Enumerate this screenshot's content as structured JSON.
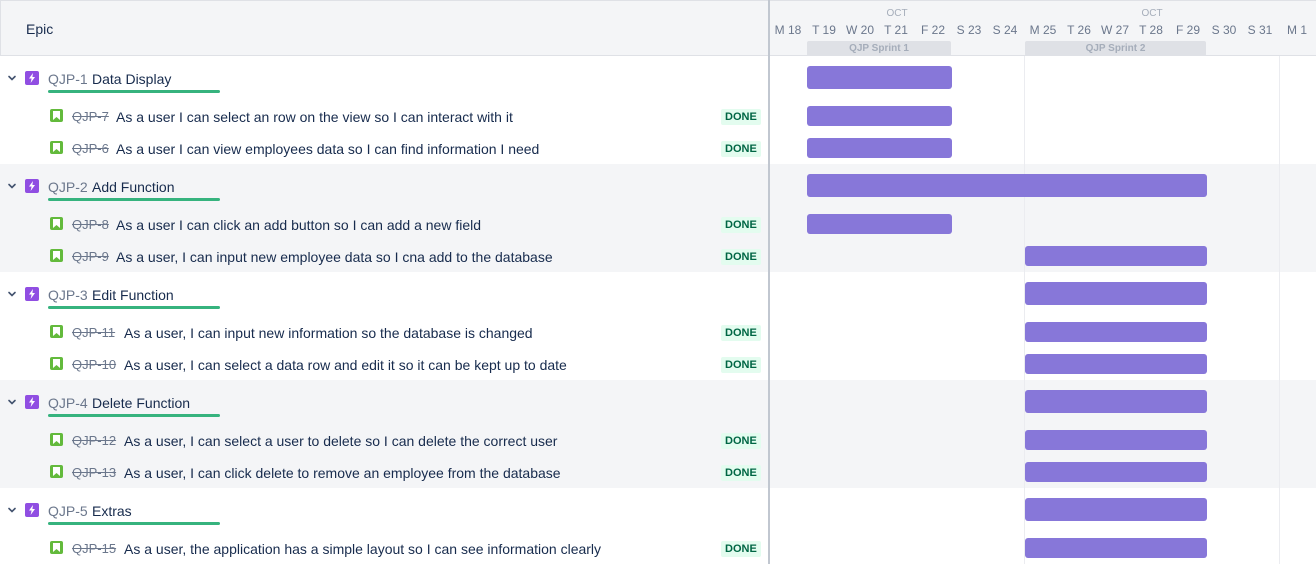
{
  "header": {
    "epic_column_title": "Epic",
    "months": [
      {
        "label": "OCT"
      },
      {
        "label": "OCT"
      }
    ],
    "days": [
      "M 18",
      "T 19",
      "W 20",
      "T 21",
      "F 22",
      "S 23",
      "S 24",
      "M 25",
      "T 26",
      "W 27",
      "T 28",
      "F 29",
      "S 30",
      "S 31",
      "M 1"
    ],
    "sprints": [
      "QJP Sprint 1",
      "QJP Sprint 2"
    ]
  },
  "epics": [
    {
      "key": "QJP-1",
      "summary": "Data Display",
      "stories": [
        {
          "key": "QJP-7",
          "summary": "As a user I can select an row on the view so I can interact with it",
          "status": "DONE"
        },
        {
          "key": "QJP-6",
          "summary": "As a user I can view employees data so I can find information I need",
          "status": "DONE"
        }
      ]
    },
    {
      "key": "QJP-2",
      "summary": "Add Function",
      "stories": [
        {
          "key": "QJP-8",
          "summary": "As a user I can click an add button so I can add a new field",
          "status": "DONE"
        },
        {
          "key": "QJP-9",
          "summary": "As a user, I can input new employee data so I cna add to the database",
          "status": "DONE"
        }
      ]
    },
    {
      "key": "QJP-3",
      "summary": "Edit Function",
      "stories": [
        {
          "key": "QJP-11",
          "summary": "As a user, I can input new information so the database is changed",
          "status": "DONE"
        },
        {
          "key": "QJP-10",
          "summary": "As a user, I can select a data row and edit it so it can be kept up to date",
          "status": "DONE"
        }
      ]
    },
    {
      "key": "QJP-4",
      "summary": "Delete Function",
      "stories": [
        {
          "key": "QJP-12",
          "summary": "As a user, I can select a user to delete so I can delete the correct user",
          "status": "DONE"
        },
        {
          "key": "QJP-13",
          "summary": "As a user, I can click delete to remove an employee from the database",
          "status": "DONE"
        }
      ]
    },
    {
      "key": "QJP-5",
      "summary": "Extras",
      "stories": [
        {
          "key": "QJP-15",
          "summary": "As a user, the application has a simple layout so I can see information clearly",
          "status": "DONE"
        }
      ]
    }
  ],
  "colors": {
    "bar": "#8777d9",
    "epic_icon": "#904ee2",
    "story_icon": "#63ba3c",
    "progress": "#36b37e",
    "done_text": "#006644",
    "done_bg": "#e3fcef"
  }
}
